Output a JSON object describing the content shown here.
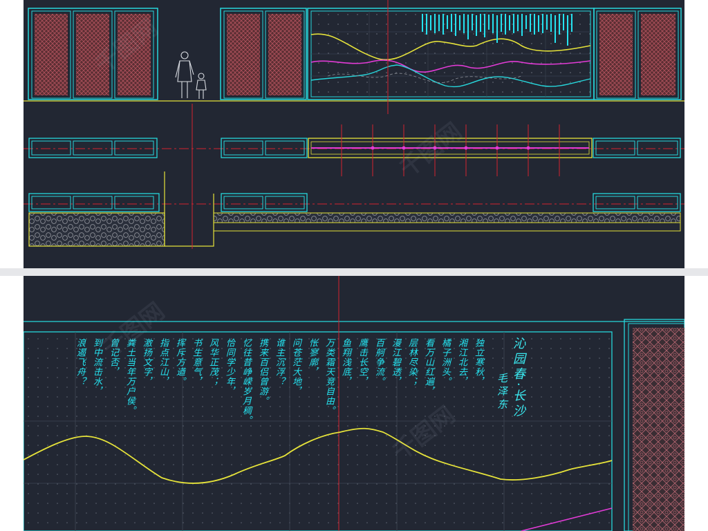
{
  "drawing": {
    "colors": {
      "background": "#222733",
      "cyan": "#27d7dc",
      "yellow": "#e6e33a",
      "magenta": "#e23bd6",
      "red": "#d4232f",
      "panel_fill": "#5b2e33",
      "gray": "#8c8f97",
      "white": "#d9dce2"
    },
    "poem_title": "沁园春·长沙",
    "poem_author": "毛泽东",
    "poem_columns": [
      "独立寒秋，",
      "湘江北去，",
      "橘子洲头。",
      "看万山红遍，",
      "层林尽染；",
      "漫江碧透，",
      "百舸争流。",
      "鹰击长空，",
      "鱼翔浅底，",
      "万类霜天竞自由。",
      "怅寥廓，",
      "问苍茫大地，",
      "谁主沉浮？",
      "携来百侣曾游。",
      "忆往昔峥嵘岁月稠。",
      "恰同学少年，",
      "风华正茂；",
      "书生意气，",
      "挥斥方遒。",
      "指点江山，",
      "激扬文字，",
      "粪土当年万户侯。",
      "曾记否，",
      "到中流击水，",
      "浪遏飞舟？"
    ],
    "watermark_text": "千图网"
  }
}
